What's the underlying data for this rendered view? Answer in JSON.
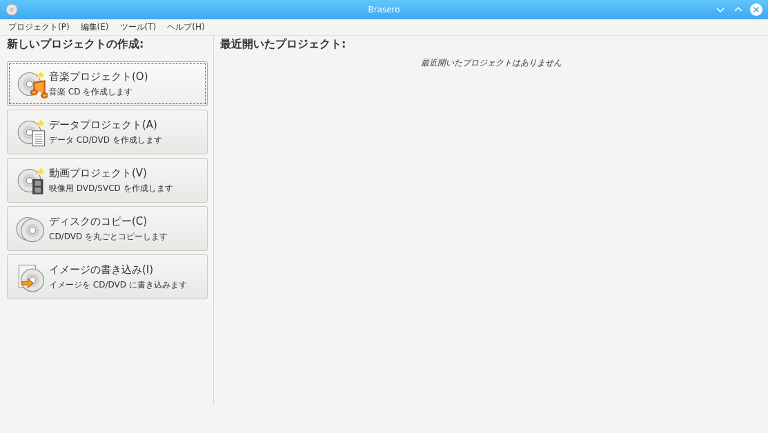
{
  "window": {
    "title": "Brasero"
  },
  "menu": [
    "プロジェクト(P)",
    "編集(E)",
    "ツール(T)",
    "ヘルプ(H)"
  ],
  "new_project": {
    "heading": "新しいプロジェクトの作成:",
    "buttons": [
      {
        "kind": "audio",
        "title": "音楽プロジェクト(O)",
        "subtitle": "音楽 CD を作成します",
        "focused": true
      },
      {
        "kind": "data",
        "title": "データプロジェクト(A)",
        "subtitle": "データ CD/DVD を作成します",
        "focused": false
      },
      {
        "kind": "video",
        "title": "動画プロジェクト(V)",
        "subtitle": "映像用 DVD/SVCD を作成します",
        "focused": false
      },
      {
        "kind": "copy",
        "title": "ディスクのコピー(C)",
        "subtitle": "CD/DVD を丸ごとコピーします",
        "focused": false
      },
      {
        "kind": "image",
        "title": "イメージの書き込み(I)",
        "subtitle": "イメージを CD/DVD に書き込みます",
        "focused": false
      }
    ]
  },
  "recent": {
    "heading": "最近開いたプロジェクト:",
    "empty_message": "最近開いたプロジェクトはありません"
  }
}
